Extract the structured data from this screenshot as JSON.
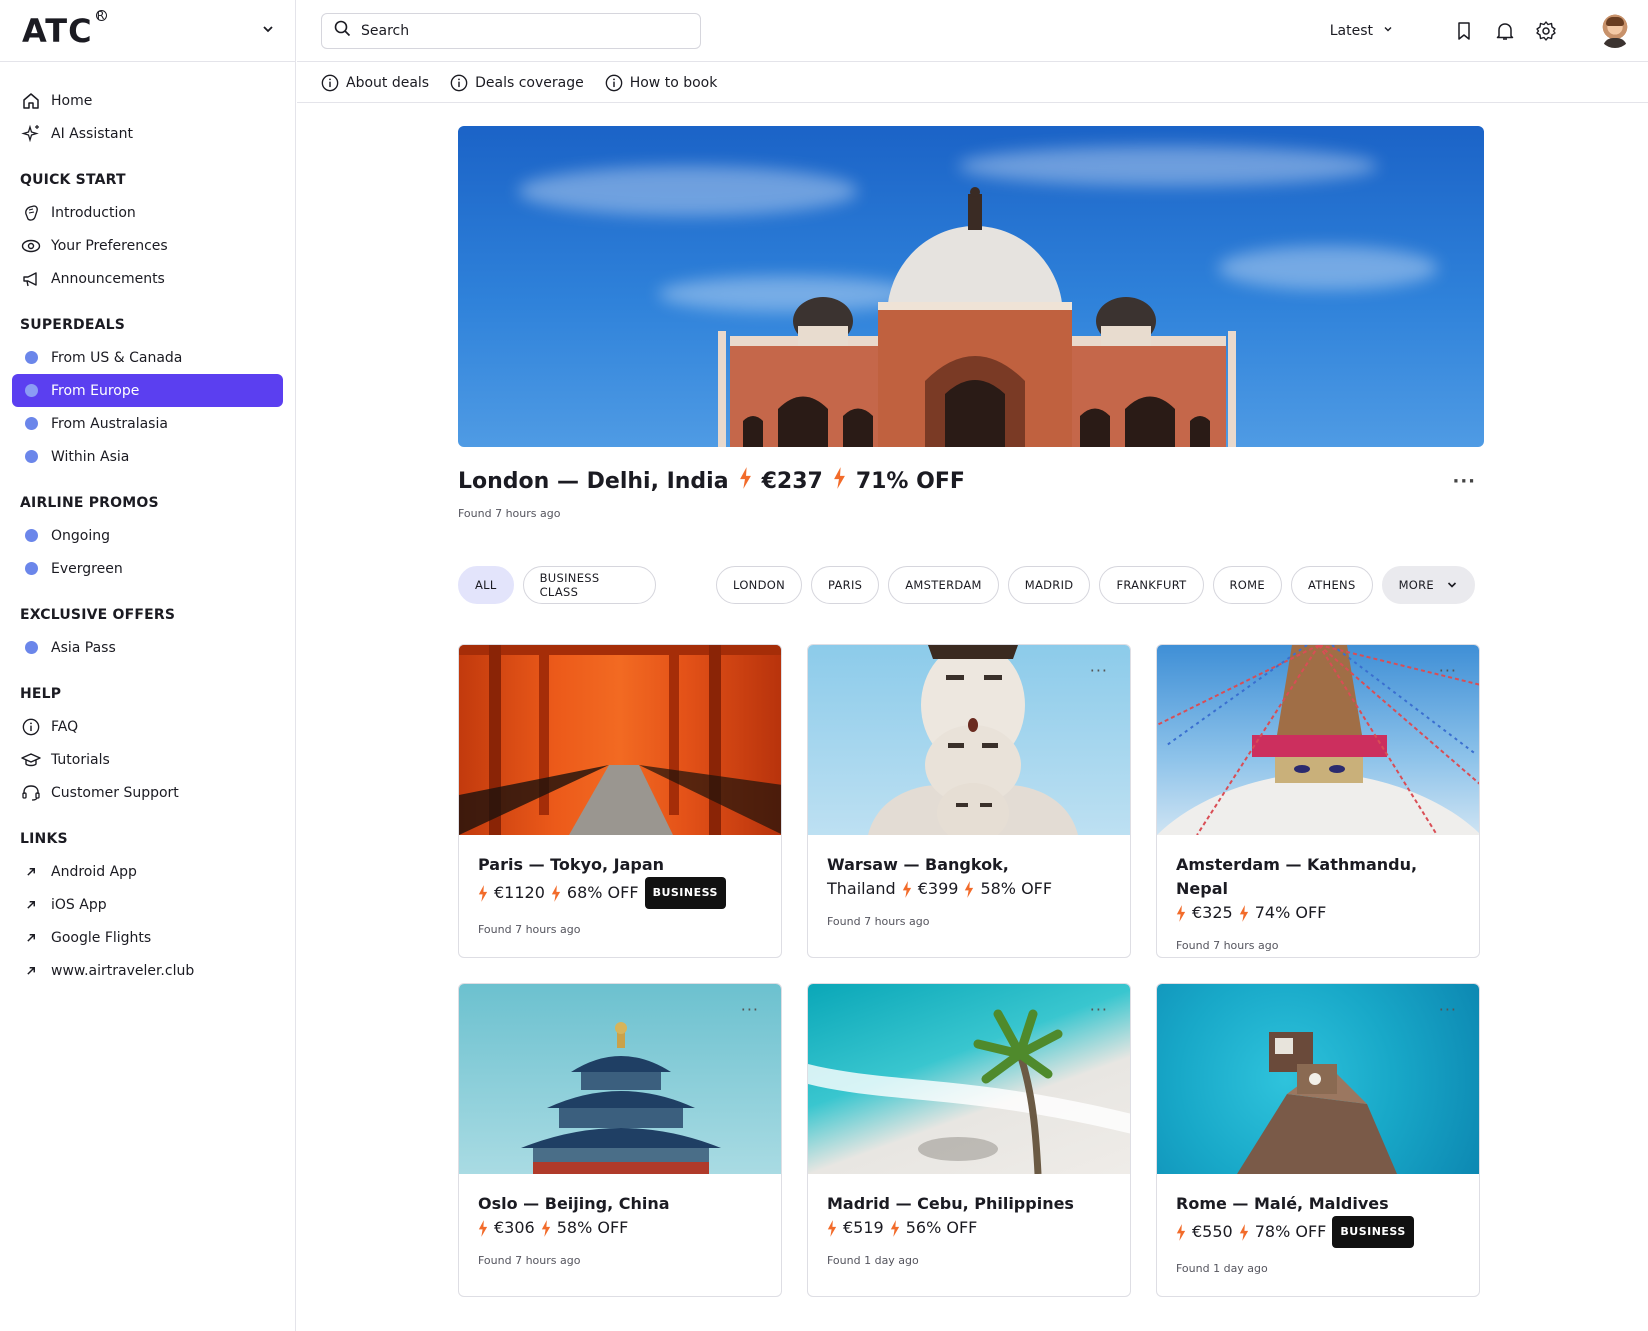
{
  "app": {
    "logo": "ATC",
    "logo_mark": "R"
  },
  "search": {
    "placeholder": "Search"
  },
  "topbar": {
    "sort_label": "Latest"
  },
  "subnav": [
    {
      "label": "About deals"
    },
    {
      "label": "Deals coverage"
    },
    {
      "label": "How to book"
    }
  ],
  "sidebar": {
    "main": [
      {
        "label": "Home",
        "icon": "home-icon"
      },
      {
        "label": "AI Assistant",
        "icon": "sparkle-icon"
      }
    ],
    "quick_start": {
      "title": "QUICK START",
      "items": [
        {
          "label": "Introduction",
          "icon": "hand-wave-icon"
        },
        {
          "label": "Your Preferences",
          "icon": "eye-icon"
        },
        {
          "label": "Announcements",
          "icon": "megaphone-icon"
        }
      ]
    },
    "superdeals": {
      "title": "SUPERDEALS",
      "items": [
        {
          "label": "From US & Canada"
        },
        {
          "label": "From Europe"
        },
        {
          "label": "From Australasia"
        },
        {
          "label": "Within Asia"
        }
      ]
    },
    "airline_promos": {
      "title": "AIRLINE PROMOS",
      "items": [
        {
          "label": "Ongoing"
        },
        {
          "label": "Evergreen"
        }
      ]
    },
    "exclusive": {
      "title": "EXCLUSIVE OFFERS",
      "items": [
        {
          "label": "Asia Pass"
        }
      ]
    },
    "help": {
      "title": "HELP",
      "items": [
        {
          "label": "FAQ",
          "icon": "info-icon"
        },
        {
          "label": "Tutorials",
          "icon": "graduation-cap-icon"
        },
        {
          "label": "Customer Support",
          "icon": "headset-icon"
        }
      ]
    },
    "links": {
      "title": "LINKS",
      "items": [
        {
          "label": "Android App"
        },
        {
          "label": "iOS App"
        },
        {
          "label": "Google Flights"
        },
        {
          "label": "www.airtraveler.club"
        }
      ]
    }
  },
  "featured": {
    "route": "London — Delhi, India",
    "price": "€237",
    "discount": "71% OFF",
    "found": "Found 7 hours ago",
    "more": "···"
  },
  "filters": [
    "ALL",
    "BUSINESS CLASS",
    "LONDON",
    "PARIS",
    "AMSTERDAM",
    "MADRID",
    "FRANKFURT",
    "ROME",
    "ATHENS",
    "MORE"
  ],
  "deals": [
    {
      "origin": "Paris",
      "dest": "Tokyo, Japan",
      "price": "€1120",
      "discount": "68% OFF",
      "badge": "BUSINESS",
      "found": "Found 7 hours ago"
    },
    {
      "origin": "Warsaw",
      "dest": "Bangkok,",
      "dest2": "Thailand",
      "price": "€399",
      "discount": "58% OFF",
      "badge": "",
      "found": "Found 7 hours ago"
    },
    {
      "origin": "Amsterdam",
      "dest": "Kathmandu, Nepal",
      "price": "€325",
      "discount": "74% OFF",
      "badge": "",
      "found": "Found 7 hours ago"
    },
    {
      "origin": "Oslo",
      "dest": "Beijing, China",
      "price": "€306",
      "discount": "58% OFF",
      "badge": "",
      "found": "Found 7 hours ago"
    },
    {
      "origin": "Madrid",
      "dest": "Cebu, Philippines",
      "price": "€519",
      "discount": "56% OFF",
      "badge": "",
      "found": "Found 1 day ago"
    },
    {
      "origin": "Rome",
      "dest": "Malé, Maldives",
      "price": "€550",
      "discount": "78% OFF",
      "badge": "BUSINESS",
      "found": "Found 1 day ago"
    }
  ],
  "colors": {
    "accent": "#5b3ff0",
    "bolt": "#f26b2a",
    "dot": "#6b86ea",
    "chip_active": "#e3e4fb"
  }
}
